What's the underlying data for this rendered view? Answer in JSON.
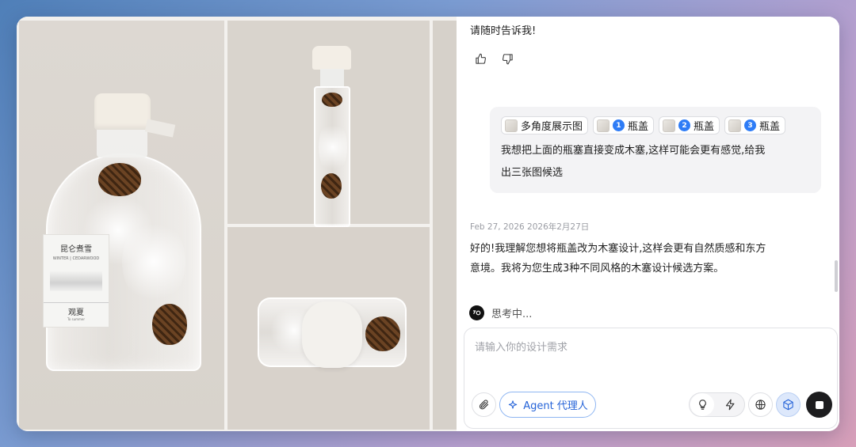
{
  "gallery": {
    "main_label": {
      "title": "昆仑煮雪",
      "subtitle": "WINTER | CEDARWOOD",
      "name": "观夏",
      "name_sub": "To summer"
    }
  },
  "chat": {
    "previous_message_tail": "请随时告诉我!",
    "user_message": {
      "chips": [
        {
          "label": "多角度展示图",
          "number": ""
        },
        {
          "label": "瓶盖",
          "number": "1"
        },
        {
          "label": "瓶盖",
          "number": "2"
        },
        {
          "label": "瓶盖",
          "number": "3"
        }
      ],
      "line1": "我想把上面的瓶塞直接变成木塞,这样可能会更有感觉,给我",
      "line2": "出三张图候选"
    },
    "timestamp": "Feb 27, 2026  2026年2月27日",
    "reply_line1": "好的!我理解您想将瓶盖改为木塞设计,这样会更有自然质感和东方",
    "reply_line2": "意境。我将为您生成3种不同风格的木塞设计候选方案。",
    "thinking_label": "思考中..."
  },
  "composer": {
    "placeholder": "请输入你的设计需求",
    "value": "",
    "agent_label": "Agent  代理人"
  },
  "colors": {
    "accent": "#2e7cf6",
    "agent_text": "#2563d8",
    "stop_button": "#1d1d1f"
  },
  "icons": [
    "thumbs-up-icon",
    "thumbs-down-icon",
    "paperclip-icon",
    "sparkle-icon",
    "lightbulb-icon",
    "lightning-icon",
    "globe-icon",
    "cube-icon",
    "stop-icon"
  ]
}
